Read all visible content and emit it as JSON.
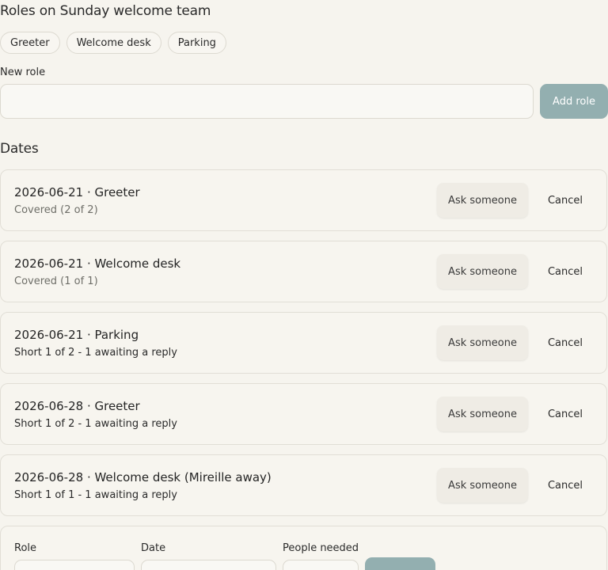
{
  "roles_section": {
    "title": "Roles on Sunday welcome team",
    "roles": [
      "Greeter",
      "Welcome desk",
      "Parking"
    ],
    "new_role_label": "New role",
    "new_role_value": "",
    "add_role_label": "Add role"
  },
  "dates_section": {
    "title": "Dates",
    "items": [
      {
        "title": "2026-06-21 · Greeter",
        "status": "Covered (2 of 2)",
        "ask_label": "Ask someone",
        "cancel_label": "Cancel"
      },
      {
        "title": "2026-06-21 · Welcome desk",
        "status": "Covered (1 of 1)",
        "ask_label": "Ask someone",
        "cancel_label": "Cancel"
      },
      {
        "title": "2026-06-21 · Parking",
        "status": "Short 1 of 2 - 1 awaiting a reply",
        "ask_label": "Ask someone",
        "cancel_label": "Cancel"
      },
      {
        "title": "2026-06-28 · Greeter",
        "status": "Short 1 of 2 - 1 awaiting a reply",
        "ask_label": "Ask someone",
        "cancel_label": "Cancel"
      },
      {
        "title": "2026-06-28 · Welcome desk (Mireille away)",
        "status": "Short 1 of 1 - 1 awaiting a reply",
        "ask_label": "Ask someone",
        "cancel_label": "Cancel"
      }
    ]
  },
  "add_date_form": {
    "role_label": "Role",
    "date_label": "Date",
    "people_label": "People needed"
  },
  "colors": {
    "background": "#f6f4ee",
    "accent_button": "#93afb0",
    "card_border": "#e1ded6"
  }
}
